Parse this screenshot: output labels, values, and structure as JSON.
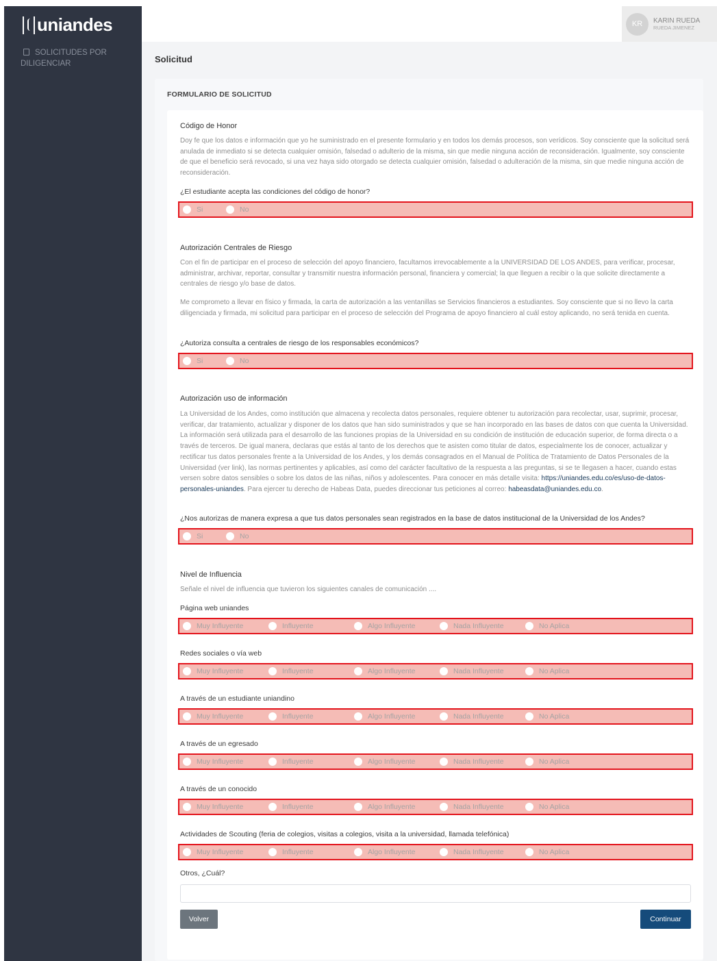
{
  "brand": {
    "logo_text": "uniandes"
  },
  "sidebar": {
    "item_label": "SOLICITUDES POR DILIGENCIAR"
  },
  "user": {
    "initials": "KR",
    "name": "KARIN RUEDA",
    "subname": "RUEDA JIMENEZ"
  },
  "page": {
    "title": "Solicitud",
    "form_title": "FORMULARIO DE SOLICITUD"
  },
  "honor": {
    "heading": "Código de Honor",
    "text": "Doy fe que los datos e información que yo he suministrado en el presente formulario y en todos los demás procesos, son verídicos. Soy consciente que la solicitud será anulada de inmediato si se detecta cualquier omisión, falsedad o adulterio de la misma, sin que medie ninguna acción de reconsideración. Igualmente, soy consciente de que el beneficio será revocado, si una vez haya sido otorgado se detecta cualquier omisión, falsedad o adulteración de la misma, sin que medie ninguna acción de reconsideración.",
    "question": "¿El estudiante acepta las condiciones del código de honor?"
  },
  "risk": {
    "heading": "Autorización Centrales de Riesgo",
    "text1": "Con el fin de participar en el proceso de selección del apoyo financiero, facultamos irrevocablemente a la UNIVERSIDAD DE LOS ANDES, para verificar, procesar, administrar, archivar, reportar, consultar y transmitir nuestra información personal, financiera y comercial; la que lleguen a recibir o la que solicite directamente a centrales de riesgo y/o base de datos.",
    "text2": "Me comprometo a llevar en físico y firmada, la carta de autorización a las ventanillas se Servicios financieros a estudiantes. Soy consciente que si no llevo la carta diligenciada y firmada, mi solicitud para participar en el proceso de selección del Programa de apoyo financiero al cuál estoy aplicando, no será tenida en cuenta.",
    "question": "¿Autoriza consulta a centrales de riesgo de los responsables económicos?"
  },
  "info": {
    "heading": "Autorización uso de información",
    "text": "La Universidad de los Andes, como institución que almacena y recolecta datos personales, requiere obtener tu autorización para recolectar, usar, suprimir, procesar, verificar, dar tratamiento, actualizar y disponer de los datos que han sido suministrados y que se han incorporado en las bases de datos con que cuenta la Universidad. La información será utilizada para el desarrollo de las funciones propias de la Universidad en su condición de institución de educación superior, de forma directa o a través de terceros. De igual manera, declaras que estás al tanto de los derechos que te asisten como titular de datos, especialmente los de conocer, actualizar y rectificar tus datos personales frente a la Universidad de los Andes, y los demás consagrados en el Manual de Política de Tratamiento de Datos Personales de la Universidad (ver link), las normas pertinentes y aplicables, así como del carácter facultativo de la respuesta a las preguntas, si se te llegasen a hacer, cuando estas versen sobre datos sensibles o sobre los datos de las niñas, niños y adolescentes. Para conocer en más detalle visita:",
    "link": "https://uniandes.edu.co/es/uso-de-datos-personales-uniandes",
    "text_after": ". Para ejercer tu derecho de Habeas Data, puedes direccionar tus peticiones al correo:",
    "email": "habeasdata@uniandes.edu.co",
    "text_end": ".",
    "question": "¿Nos autorizas de manera expresa a que tus datos personales sean registrados en la base de datos institucional de la Universidad de los Andes?"
  },
  "yesno": {
    "yes": "Si",
    "no": "No"
  },
  "influence": {
    "heading": "Nivel de Influencia",
    "subtitle": "Señale el nivel de influencia que tuvieron los siguientes canales de comunicación ....",
    "options": [
      "Muy Influyente",
      "Influyente",
      "Algo Influyente",
      "Nada Influyente",
      "No Aplica"
    ],
    "channels": [
      "Página web uniandes",
      "Redes sociales o vía web",
      "A través de un estudiante uniandino",
      "A través de un egresado",
      "A través de un conocido",
      "Actividades de Scouting (feria de colegios, visitas a colegios, visita a la universidad, llamada telefónica)"
    ],
    "other_label": "Otros, ¿Cuál?",
    "other_value": ""
  },
  "buttons": {
    "back": "Volver",
    "next": "Continuar"
  },
  "colors": {
    "sidebar": "#2f3542",
    "error_border": "#e3131b",
    "error_fill": "#f5bcb6",
    "primary": "#154b7b",
    "secondary": "#6c757d"
  }
}
